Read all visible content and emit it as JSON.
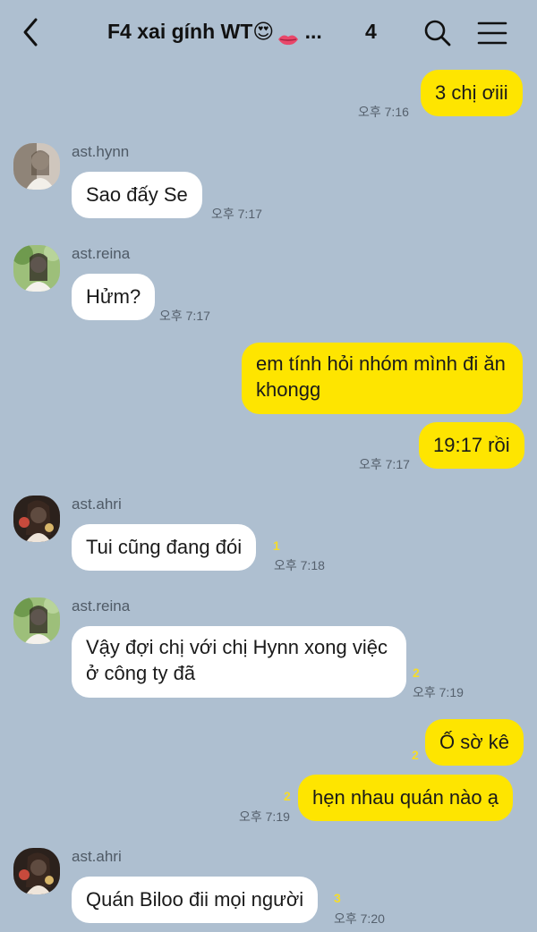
{
  "header": {
    "title": "F4 xai gính WT😍",
    "title_ellipsis": "...",
    "member_count": "4",
    "icons": {
      "back": "chevron-left-icon",
      "search": "search-icon",
      "menu": "hamburger-menu-icon"
    }
  },
  "messages": [
    {
      "from": "me",
      "text": "3 chị ơiii",
      "time": "오후 7:16"
    },
    {
      "from": "ast.hynn",
      "sender": "ast.hynn",
      "text": "Sao đấy Se",
      "time": "오후 7:17"
    },
    {
      "from": "ast.reina",
      "sender": "ast.reina",
      "text": "Hửm?",
      "time": "오후 7:17"
    },
    {
      "from": "me",
      "text": "em tính hỏi nhóm mình đi ăn khongg"
    },
    {
      "from": "me",
      "text": "19:17 rồi",
      "time": "오후 7:17"
    },
    {
      "from": "ast.ahri",
      "sender": "ast.ahri",
      "text": "Tui cũng đang đói",
      "unread": "1",
      "time": "오후 7:18"
    },
    {
      "from": "ast.reina",
      "sender": "ast.reina",
      "text": "Vậy đợi chị với chị Hynn xong việc ở công ty đã",
      "unread": "2",
      "time": "오후 7:19"
    },
    {
      "from": "me",
      "text": "Ố sờ kê",
      "unread": "2"
    },
    {
      "from": "me",
      "text": "hẹn nhau quán nào ạ",
      "unread": "2",
      "time": "오후 7:19"
    },
    {
      "from": "ast.ahri",
      "sender": "ast.ahri",
      "text": "Quán Biloo đii mọi người",
      "unread": "3",
      "time": "오후 7:20"
    }
  ],
  "colors": {
    "background": "#aebfd0",
    "my_bubble": "#fee500",
    "their_bubble": "#ffffff",
    "unread_count": "#f5dc2a"
  }
}
